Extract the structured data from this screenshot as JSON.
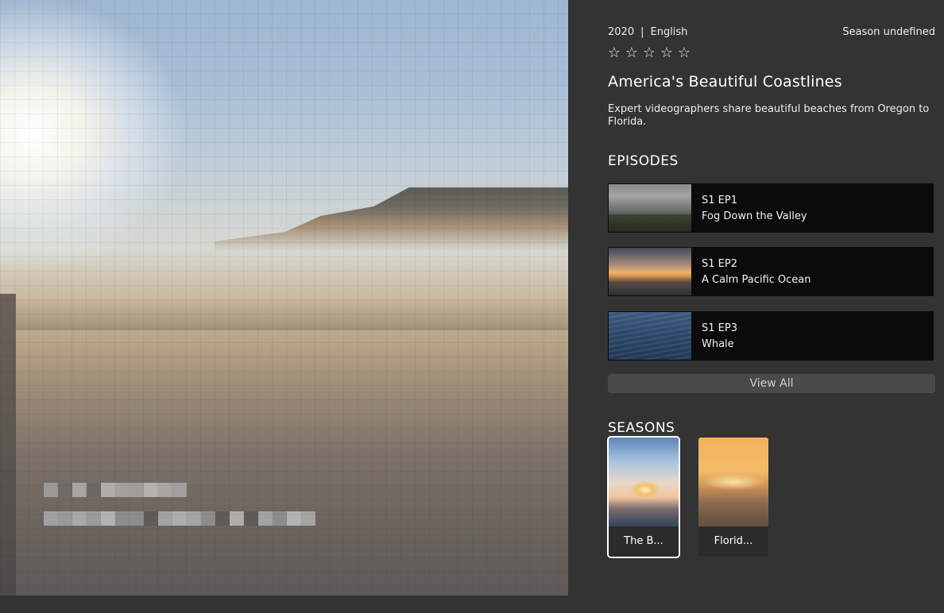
{
  "show": {
    "year": "2020",
    "separator": "|",
    "language": "English",
    "season_label": "Season undefined",
    "rating_stars": 0,
    "rating_max": 5,
    "title": "America's Beautiful Coastlines",
    "description": "Expert videographers share beautiful beaches from Oregon to Florida."
  },
  "episodes_section": {
    "heading": "EPISODES",
    "items": [
      {
        "number": "S1 EP1",
        "title": "Fog Down the Valley",
        "thumb": "foggy-valley"
      },
      {
        "number": "S1 EP2",
        "title": "A Calm Pacific Ocean",
        "thumb": "pacific-sunset"
      },
      {
        "number": "S1 EP3",
        "title": "Whale",
        "thumb": "ocean-water"
      }
    ],
    "view_all_label": "View All"
  },
  "seasons_section": {
    "heading": "SEASONS",
    "items": [
      {
        "label": "The B...",
        "selected": true
      },
      {
        "label": "Florid...",
        "selected": false
      }
    ]
  },
  "icons": {
    "star": "☆"
  }
}
